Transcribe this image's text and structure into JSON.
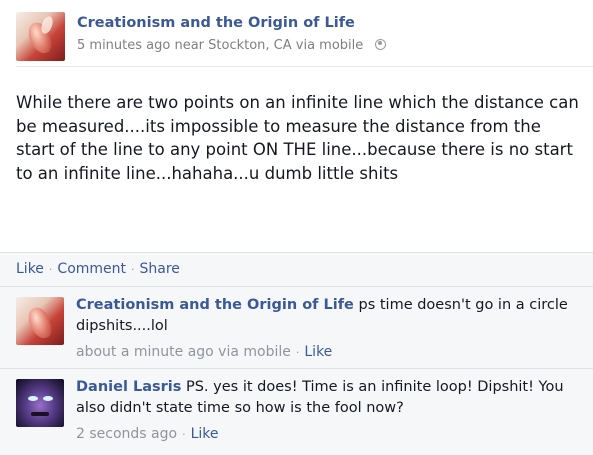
{
  "post": {
    "author": "Creationism and the Origin of Life",
    "meta": "5 minutes ago near Stockton, CA via mobile",
    "body": "While there are two points on an infinite line which the distance can be measured....its impossible to measure the distance from the start of the line to any point ON THE line...because there is no start to an infinite line...hahaha...u dumb little shits",
    "privacy_icon": "globe-icon"
  },
  "actions": {
    "like": "Like",
    "comment": "Comment",
    "share": "Share",
    "separator": "·"
  },
  "comments": [
    {
      "author": "Creationism and the Origin of Life",
      "text": " ps time doesn't go in a circle dipshits....lol",
      "time": "about a minute ago via mobile",
      "like": "Like"
    },
    {
      "author": "Daniel Lasris",
      "text": " PS. yes it does! Time is an infinite loop! Dipshit! You also didn't state time so how is the fool now?",
      "time": "2 seconds ago",
      "like": "Like"
    }
  ],
  "colors": {
    "link": "#3b5998",
    "meta": "#90949c",
    "comment_bg": "#f6f7f8"
  }
}
